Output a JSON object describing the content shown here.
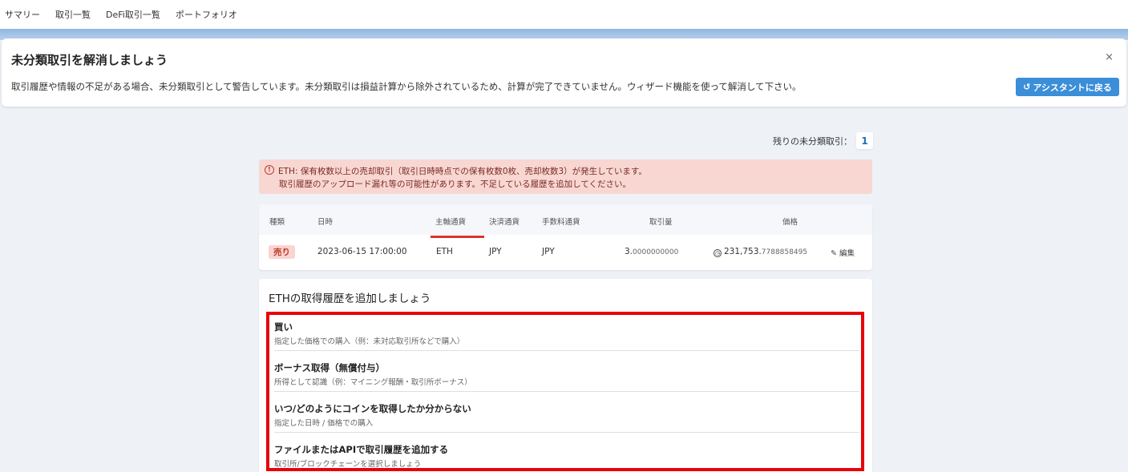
{
  "nav": {
    "items": [
      "サマリー",
      "取引一覧",
      "DeFi取引一覧",
      "ポートフォリオ"
    ]
  },
  "banner": {
    "title": "未分類取引を解消しましょう",
    "description": "取引履歴や情報の不足がある場合、未分類取引として警告しています。未分類取引は損益計算から除外されているため、計算が完了できていません。ウィザード機能を使って解消して下さい。",
    "close": "×",
    "assistant_button": "アシスタントに戻る",
    "assistant_icon": "↺"
  },
  "remaining": {
    "label": "残りの未分類取引：",
    "count": "1"
  },
  "alert": {
    "icon": "!",
    "line1": "ETH: 保有枚数以上の売却取引（取引日時時点での保有枚数0枚、売却枚数3）が発生しています。",
    "line2": "取引履歴のアップロード漏れ等の可能性があります。不足している履歴を追加してください。"
  },
  "table": {
    "headers": {
      "type": "種類",
      "date": "日時",
      "base": "主軸通貨",
      "settle": "決済通貨",
      "fee": "手数料通貨",
      "amount": "取引量",
      "price": "価格"
    },
    "row": {
      "type": "売り",
      "date": "2023-06-15 17:00:00",
      "base": "ETH",
      "settle": "JPY",
      "fee": "JPY",
      "amount_int": "3.",
      "amount_dec": "0000000000",
      "price_main": "231,753.",
      "price_dec": "7788858495",
      "edit": "編集"
    }
  },
  "acquisition": {
    "title": "ETHの取得履歴を追加しましょう",
    "options": [
      {
        "title": "買い",
        "subtitle": "指定した価格での購入（例：未対応取引所などで購入）"
      },
      {
        "title": "ボーナス取得（無償付与）",
        "subtitle": "所得として認識（例：マイニング報酬・取引所ボーナス）"
      },
      {
        "title": "いつ/どのようにコインを取得したか分からない",
        "subtitle": "指定した日時 / 価格での購入"
      },
      {
        "title": "ファイルまたはAPIで取引履歴を追加する",
        "subtitle": "取引所/ブロックチェーンを選択しましょう"
      }
    ]
  }
}
